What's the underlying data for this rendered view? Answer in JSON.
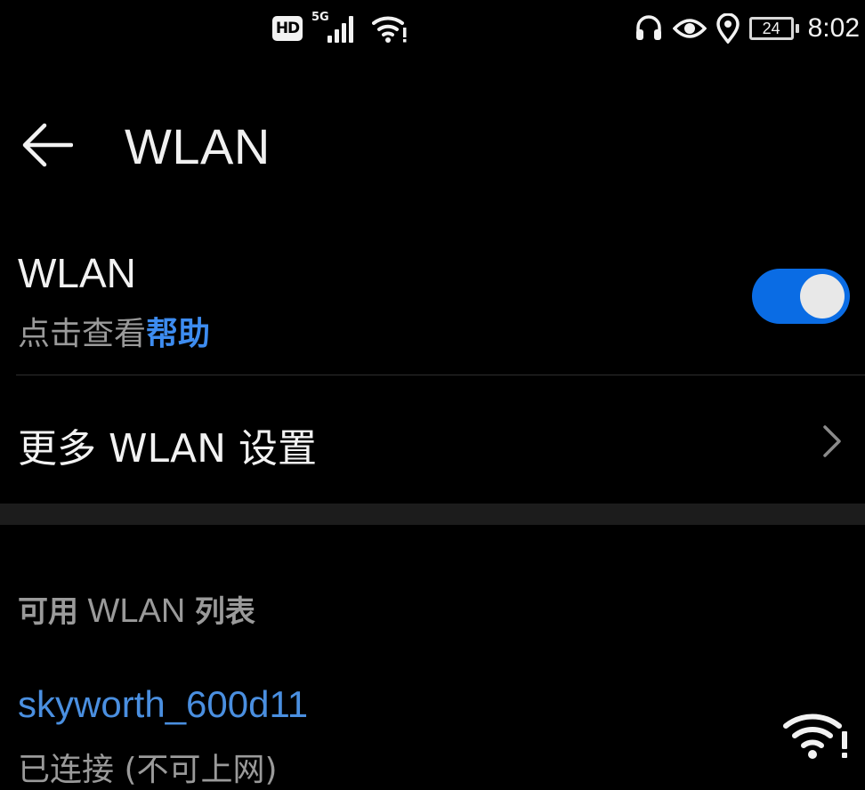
{
  "status_bar": {
    "hd_label": "HD",
    "network_type": "5G",
    "battery_level": "24",
    "time": "8:02",
    "icons": [
      "hd-icon",
      "cellular-signal-icon",
      "wifi-warning-icon",
      "headset-icon",
      "eye-icon",
      "location-icon",
      "battery-icon"
    ]
  },
  "app_bar": {
    "back_icon": "arrow-left-icon",
    "title": "WLAN"
  },
  "wlan_toggle": {
    "label": "WLAN",
    "help_prefix": "点击查看",
    "help_link": "帮助",
    "enabled": true,
    "on_color": "#0a6ce4"
  },
  "more_settings": {
    "label": "更多 WLAN 设置",
    "icon": "chevron-right-icon"
  },
  "available_list": {
    "header_part1": "可用",
    "header_part2": " WLAN ",
    "header_part3": "列表",
    "networks": [
      {
        "ssid": "skyworth_600d11",
        "status": "已连接 (不可上网)",
        "signal_icon": "wifi-warning-icon",
        "name_color": "#4a8fe0"
      }
    ]
  },
  "colors": {
    "background": "#000000",
    "primary_text": "#f2f2f2",
    "secondary_text": "#9a9a9a",
    "accent": "#3d8cf0"
  }
}
